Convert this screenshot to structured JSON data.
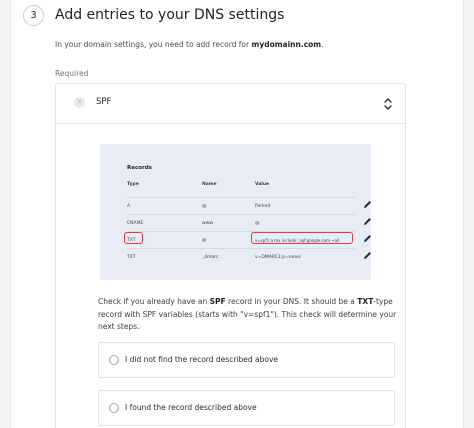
{
  "step": {
    "number": "3",
    "title": "Add entries to your DNS settings",
    "description_prefix": "In your domain settings, you need to add record for ",
    "domain": "mydomainn.com",
    "description_suffix": ".",
    "required_label": "Required"
  },
  "record": {
    "label": "SPF",
    "status_glyph": "✕"
  },
  "dns_preview": {
    "title": "Records",
    "columns": [
      "Type",
      "Name",
      "Value"
    ],
    "rows": [
      {
        "type": "A",
        "name": "@",
        "value": "Parked"
      },
      {
        "type": "CNAME",
        "name": "www",
        "value": "@"
      },
      {
        "type": "TXT",
        "name": "@",
        "value": "v=spf1 a mx include:_spf.google.com ~all"
      },
      {
        "type": "TXT",
        "name": "_dmarc",
        "value": "v=DMARC1;p=none;"
      }
    ],
    "highlight_color": "#e23b3b",
    "background_color": "#e7ecf6"
  },
  "instructions": {
    "p1": "Check if you already have an ",
    "b1": "SPF",
    "p2": " record in your DNS. It should be a ",
    "b2": "TXT",
    "p3": "-type record with SPF variables (starts with \"v=spf1\"). This check will determine your next steps."
  },
  "options": [
    {
      "label": "I did not find the record described above",
      "selected": false
    },
    {
      "label": "I found the record described above",
      "selected": false
    }
  ]
}
